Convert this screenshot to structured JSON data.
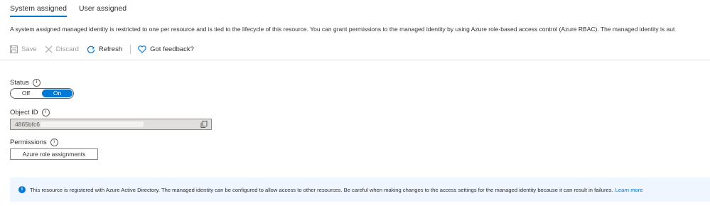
{
  "tabs": [
    {
      "label": "System assigned",
      "active": true
    },
    {
      "label": "User assigned",
      "active": false
    }
  ],
  "description": "A system assigned managed identity is restricted to one per resource and is tied to the lifecycle of this resource. You can grant permissions to the managed identity by using Azure role-based access control (Azure RBAC). The managed identity is aut",
  "toolbar": {
    "save_label": "Save",
    "discard_label": "Discard",
    "refresh_label": "Refresh",
    "feedback_label": "Got feedback?"
  },
  "status": {
    "label": "Status",
    "off_label": "Off",
    "on_label": "On",
    "value": "On"
  },
  "object_id": {
    "label": "Object ID",
    "value": "4865bfc6"
  },
  "permissions": {
    "label": "Permissions",
    "button_label": "Azure role assignments"
  },
  "banner": {
    "text": "This resource is registered with Azure Active Directory. The managed identity can be configured to allow access to other resources. Be careful when making changes to the access settings for the managed identity because it can result in failures.",
    "link_label": "Learn more"
  },
  "colors": {
    "accent": "#0078d4",
    "banner_bg": "#f0f6ff",
    "disabled_text": "#a19f9d"
  }
}
